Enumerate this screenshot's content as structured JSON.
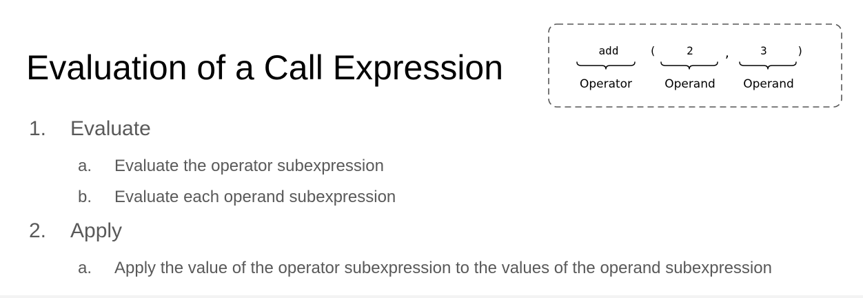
{
  "title": "Evaluation of a Call Expression",
  "diagram": {
    "expression": {
      "operator": "add",
      "open_paren": "(",
      "operand1": "2",
      "comma": ",",
      "operand2": "3",
      "close_paren": ")"
    },
    "labels": {
      "operator": "Operator",
      "operand1": "Operand",
      "operand2": "Operand"
    }
  },
  "steps": [
    {
      "number": "1.",
      "text": "Evaluate",
      "substeps": [
        {
          "letter": "a.",
          "text": "Evaluate the operator subexpression"
        },
        {
          "letter": "b.",
          "text": "Evaluate each operand subexpression"
        }
      ]
    },
    {
      "number": "2.",
      "text": "Apply",
      "substeps": [
        {
          "letter": "a.",
          "text": "Apply the value of the operator subexpression to the values of the operand subexpression"
        }
      ]
    }
  ]
}
